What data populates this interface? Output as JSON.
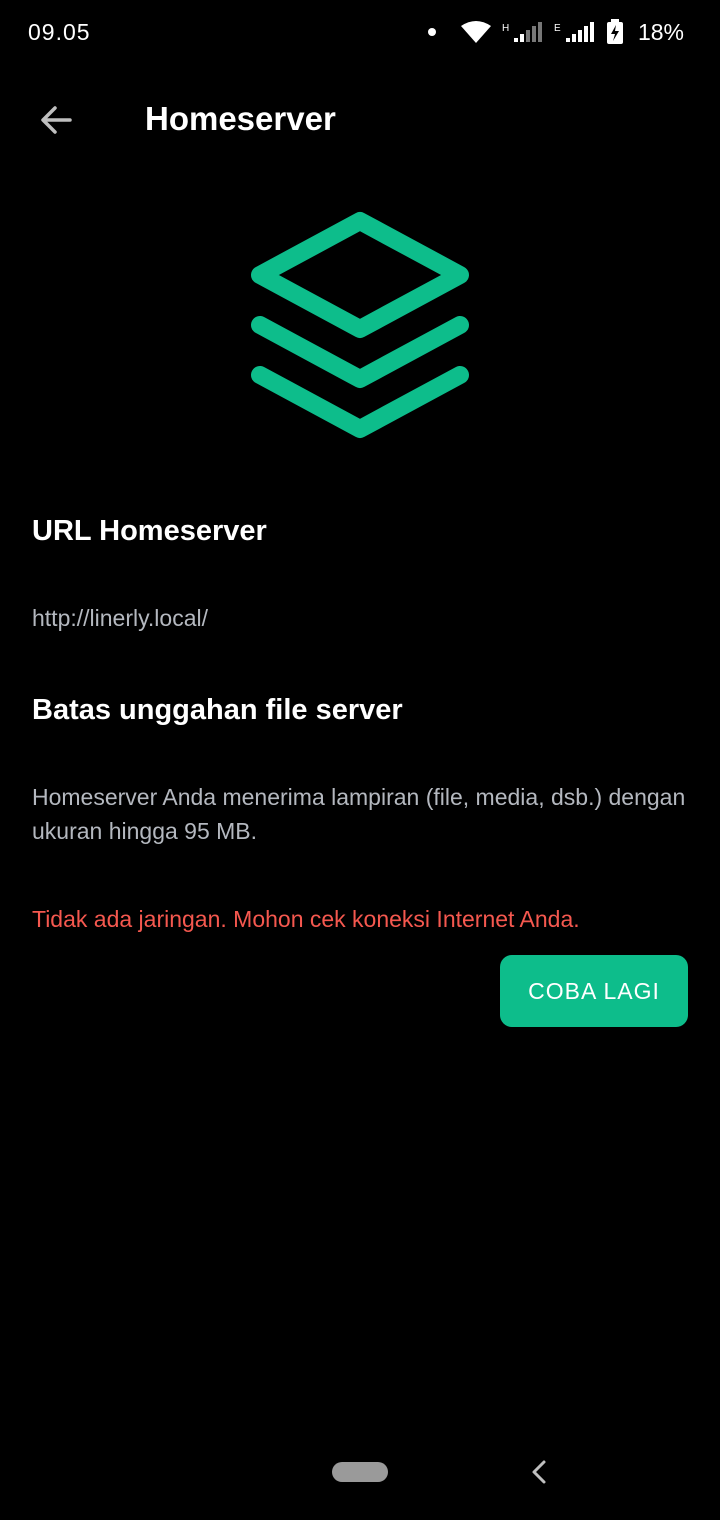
{
  "status_bar": {
    "time": "09.05",
    "battery": "18%",
    "network_1": "H",
    "network_2": "E"
  },
  "app_bar": {
    "title": "Homeserver"
  },
  "homeserver_url": {
    "title": "URL Homeserver",
    "value": "http://linerly.local/"
  },
  "upload_limit": {
    "title": "Batas unggahan file server",
    "description": "Homeserver Anda menerima lampiran (file, media, dsb.) dengan ukuran hingga 95 MB."
  },
  "error": {
    "message": "Tidak ada jaringan. Mohon cek koneksi Internet Anda."
  },
  "retry_button": {
    "label": "COBA LAGI"
  },
  "colors": {
    "accent": "#0dbd8b",
    "error": "#f5584f",
    "background": "#000000",
    "secondary_text": "#b4b8bf"
  },
  "icons": {
    "back": "arrow-left-icon",
    "logo": "layers-icon",
    "wifi": "wifi-icon",
    "battery": "battery-charging-icon"
  }
}
